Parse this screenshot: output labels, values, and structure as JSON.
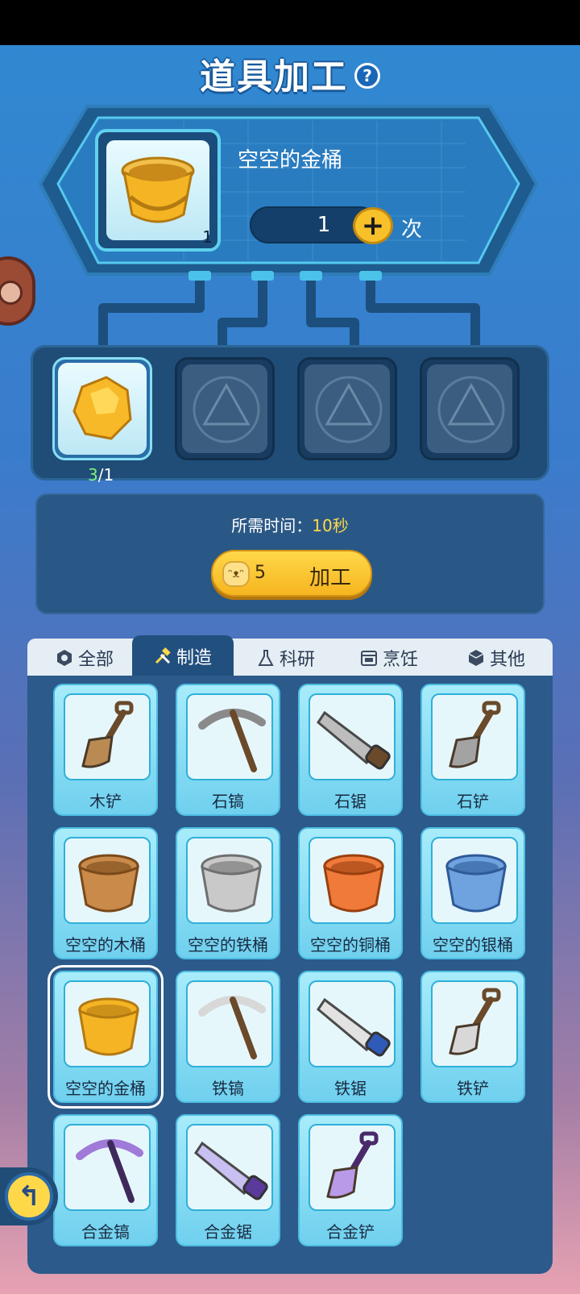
{
  "header": {
    "title": "道具加工",
    "help_label": "?"
  },
  "product": {
    "name": "空空的金桶",
    "count": "1",
    "quantity": "1",
    "unit": "次",
    "plus_label": "+"
  },
  "ingredients": {
    "have": "3",
    "need": "/1"
  },
  "process": {
    "time_label": "所需时间：",
    "time_value": "10秒",
    "cost": "5",
    "button_label": "加工"
  },
  "tabs": [
    {
      "label": "全部",
      "icon": "hexagon-icon"
    },
    {
      "label": "制造",
      "icon": "tools-icon"
    },
    {
      "label": "科研",
      "icon": "flask-icon"
    },
    {
      "label": "烹饪",
      "icon": "stove-icon"
    },
    {
      "label": "其他",
      "icon": "cube-icon"
    }
  ],
  "items": [
    {
      "label": "木铲",
      "icon": "wooden-shovel-icon"
    },
    {
      "label": "石镐",
      "icon": "stone-pickaxe-icon"
    },
    {
      "label": "石锯",
      "icon": "stone-saw-icon"
    },
    {
      "label": "石铲",
      "icon": "stone-shovel-icon"
    },
    {
      "label": "空空的木桶",
      "icon": "wooden-bucket-icon"
    },
    {
      "label": "空空的铁桶",
      "icon": "iron-bucket-icon"
    },
    {
      "label": "空空的铜桶",
      "icon": "copper-bucket-icon"
    },
    {
      "label": "空空的银桶",
      "icon": "silver-bucket-icon"
    },
    {
      "label": "空空的金桶",
      "icon": "gold-bucket-icon",
      "selected": true
    },
    {
      "label": "铁镐",
      "icon": "iron-pickaxe-icon"
    },
    {
      "label": "铁锯",
      "icon": "iron-saw-icon"
    },
    {
      "label": "铁铲",
      "icon": "iron-shovel-icon"
    },
    {
      "label": "合金镐",
      "icon": "alloy-pickaxe-icon"
    },
    {
      "label": "合金锯",
      "icon": "alloy-saw-icon"
    },
    {
      "label": "合金铲",
      "icon": "alloy-shovel-icon"
    }
  ],
  "colors": {
    "accent_yellow": "#f8c12a",
    "panel_blue": "#2c5a8a",
    "card_cyan": "#6fd0ee",
    "have_green": "#7ff079"
  }
}
